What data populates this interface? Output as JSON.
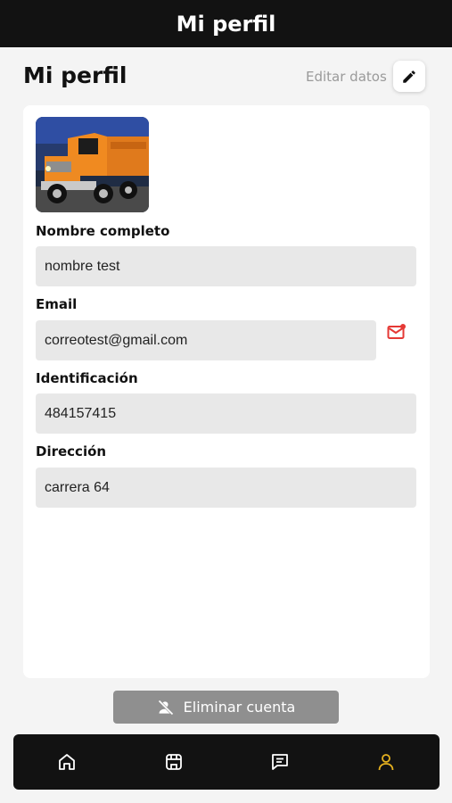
{
  "header": {
    "title": "Mi perfil"
  },
  "page": {
    "title": "Mi perfil",
    "edit_label": "Editar datos"
  },
  "profile": {
    "photo_alt": "orange dump truck",
    "fields": [
      {
        "label": "Nombre completo",
        "value": "nombre test"
      },
      {
        "label": "Email",
        "value": "correotest@gmail.com"
      },
      {
        "label": "Identificación",
        "value": "484157415"
      },
      {
        "label": "Dirección",
        "value": "carrera 64"
      }
    ]
  },
  "actions": {
    "delete_account": "Eliminar cuenta"
  },
  "nav": {
    "items": [
      {
        "icon": "home-icon",
        "active": false
      },
      {
        "icon": "store-icon",
        "active": false
      },
      {
        "icon": "chat-icon",
        "active": false
      },
      {
        "icon": "user-icon",
        "active": true
      }
    ],
    "active_color": "#e7b21f"
  },
  "colors": {
    "accent": "#e7b21f",
    "email_alert": "#e53935"
  }
}
